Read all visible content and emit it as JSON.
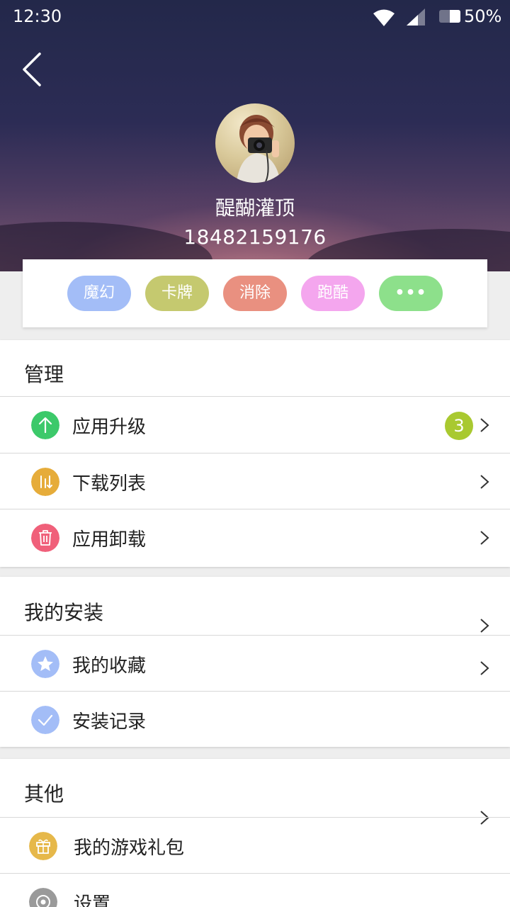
{
  "status_bar": {
    "time": "12:30",
    "battery": "50%"
  },
  "profile": {
    "username": "醍醐灌顶",
    "phone": "18482159176"
  },
  "tags": [
    {
      "label": "魔幻",
      "color": "#a3bdf7"
    },
    {
      "label": "卡牌",
      "color": "#c5c96f"
    },
    {
      "label": "消除",
      "color": "#e99080"
    },
    {
      "label": "跑酷",
      "color": "#f4a6ee"
    },
    {
      "label": "•••",
      "color": "#8de08b"
    }
  ],
  "sections": {
    "manage": {
      "title": "管理",
      "items": [
        {
          "label": "应用升级",
          "icon": "arrow-up-icon",
          "color": "#3cc96a",
          "badge": "3"
        },
        {
          "label": "下载列表",
          "icon": "download-list-icon",
          "color": "#e6ac3a"
        },
        {
          "label": "应用卸载",
          "icon": "trash-icon",
          "color": "#f0607a"
        }
      ]
    },
    "installs": {
      "title": "我的安装",
      "items": [
        {
          "label": "我的收藏",
          "icon": "star-icon",
          "color": "#a3bdf7"
        },
        {
          "label": "安装记录",
          "icon": "check-icon",
          "color": "#a3bdf7"
        }
      ]
    },
    "other": {
      "title": "其他",
      "items": [
        {
          "label": "我的游戏礼包",
          "icon": "gift-icon",
          "color": "#e6b84a"
        },
        {
          "label": "设置",
          "icon": "gear-icon",
          "color": "#9a9a9a"
        }
      ]
    }
  }
}
